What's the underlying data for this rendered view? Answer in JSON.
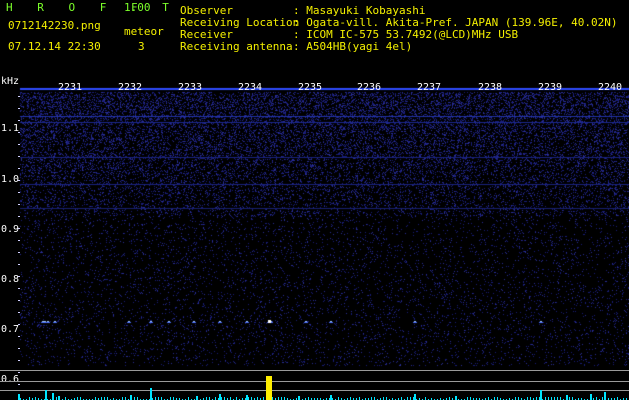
{
  "header": {
    "app_title": "H R O F F T",
    "version": "1.00",
    "file_name": "0712142230.png",
    "timestamp": "07.12.14 22:30",
    "meteor_label": "meteor",
    "meteor_count": "3",
    "info": [
      {
        "label": "Observer",
        "value": ": Masayuki Kobayashi"
      },
      {
        "label": "Receiving Location",
        "value": ": Ogata-vill. Akita-Pref. JAPAN (139.96E, 40.02N)"
      },
      {
        "label": "Receiver",
        "value": ": ICOM IC-575 53.7492(@LCD)MHz USB"
      },
      {
        "label": "Receiving antenna",
        "value": ": A504HB(yagi 4el)"
      }
    ]
  },
  "plot": {
    "y_unit": "kHz",
    "y_ticks": [
      "1.1",
      "1.0",
      "0.9",
      "0.8",
      "0.7",
      "0.6"
    ],
    "x_ticks": [
      "2231",
      "2232",
      "2233",
      "2234",
      "2235",
      "2236",
      "2237",
      "2238",
      "2239",
      "2240"
    ],
    "colors": {
      "background": "#000000",
      "band": "#2f4cff",
      "noise": "#1a1e7a",
      "echo": "#9fc8ff",
      "trace_cyan": "#00e5ff",
      "trace_yellow": "#ffee00",
      "grid": "#9a9a9a"
    }
  }
}
